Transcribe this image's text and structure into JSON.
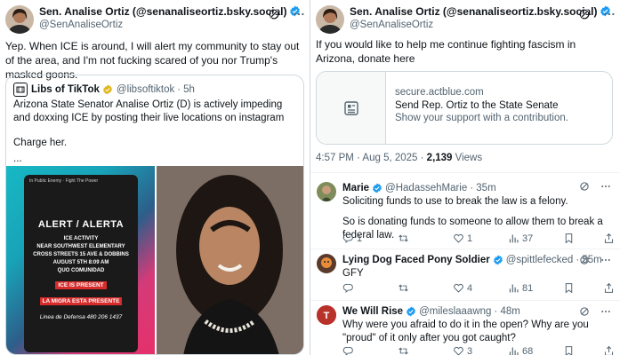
{
  "left_tweet": {
    "author_name": "Sen. Analise Ortiz (@senanaliseortiz.bsky.social)",
    "handle": "@SenAnaliseOrtiz",
    "text": "Yep. When ICE is around, I will alert my community to stay out of the area, and I'm not fucking scared of you nor Trump's masked goons.",
    "quote": {
      "author_name": "Libs of TikTok",
      "handle": "@libsoftiktok",
      "dot": "·",
      "time": "5h",
      "text_p1": "Arizona State Senator Analise Ortiz (D) is actively impeding and doxxing ICE by posting their live locations on instagram",
      "text_p2": "Charge her.",
      "text_p3": "...",
      "image1": {
        "top_caption": "In Public Enemy · Fight The Power",
        "title": "ALERT / ALERTA",
        "lines": [
          "ICE ACTIVITY",
          "NEAR SOUTHWEST ELEMENTARY",
          "CROSS STREETS 15 AVE & DOBBINS",
          "AUGUST 5TH 8:09 AM",
          "QUO COMUNIDAD"
        ],
        "red1": "ICE IS PRESENT",
        "red2": "LA MIGRA ESTA PRESENTE",
        "footer": "Linea de Defensa 480 206 1437"
      }
    }
  },
  "right_tweet": {
    "author_name": "Sen. Analise Ortiz (@senanaliseortiz.bsky.social)",
    "handle": "@SenAnaliseOrtiz",
    "text": "If you would like to help me continue fighting fascism in Arizona, donate here",
    "link_card": {
      "domain": "secure.actblue.com",
      "title": "Send Rep. Ortiz to the State Senate",
      "subtitle": "Show your support with a contribution."
    },
    "meta_time": "4:57 PM · Aug 5, 2025 · ",
    "meta_views_count": "2,139",
    "meta_views_label": " Views"
  },
  "replies": [
    {
      "name": "Marie",
      "handle": "@HadassehMarie",
      "time": "· 35m",
      "lines": [
        "Soliciting funds to use to break the law is a felony.",
        "So is donating funds to someone to allow them to break a federal law."
      ],
      "replies": "1",
      "reposts": "",
      "likes": "1",
      "views": "37"
    },
    {
      "name": "Lying Dog Faced Pony Soldier",
      "handle": "@spittlefecked",
      "time": "· 55m",
      "lines": [
        "GFY"
      ],
      "replies": "",
      "reposts": "",
      "likes": "4",
      "views": "81"
    },
    {
      "name": "We Will Rise",
      "handle": "@mileslaaawng",
      "time": "· 48m",
      "lines": [
        "Why were you afraid to do it in the open? Why are you \"proud\" of it only after you got caught?"
      ],
      "replies": "",
      "reposts": "",
      "likes": "3",
      "views": "68"
    }
  ],
  "colors": {
    "verified": "#1d9bf0",
    "gold_badge": "#e2b719",
    "gray": "#536471",
    "border": "#cfd9de"
  }
}
